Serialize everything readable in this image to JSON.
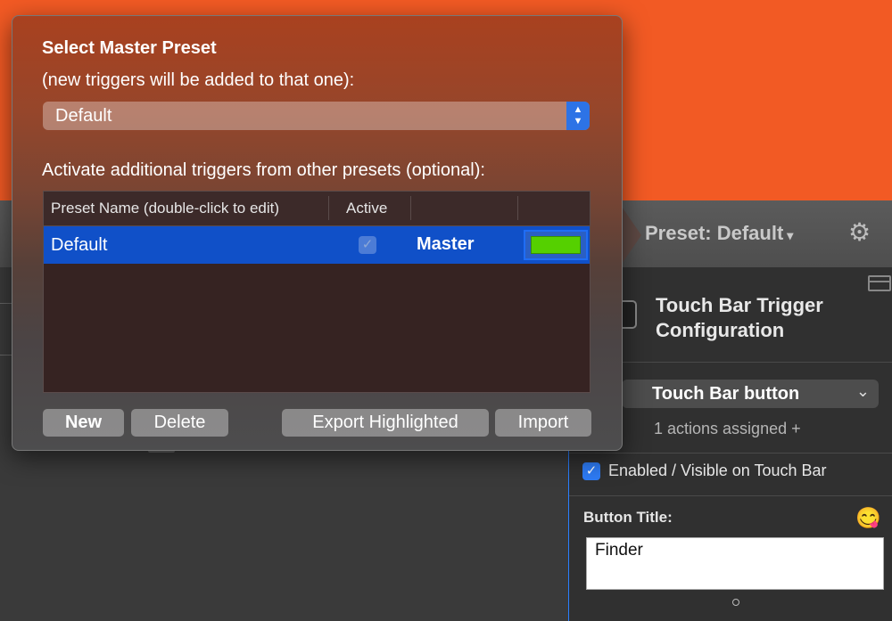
{
  "colors": {
    "background_orange": "#f25a24",
    "selection_blue": "#1050c8",
    "accent_blue": "#2e7cf6",
    "swatch_green": "#55d000"
  },
  "toolbar": {
    "preset_label": "Preset: Default",
    "preset_arrow": "▾",
    "settings_icon": "gear-icon"
  },
  "trigger_config": {
    "title": "Touch Bar Trigger Configuration",
    "trigger_type": "Touch Bar button",
    "actions_assigned": "1 actions assigned +",
    "enabled_label": "Enabled / Visible on Touch Bar",
    "enabled_checked": true,
    "button_title_label": "Button Title:",
    "emoji_picker_icon": "😋",
    "button_title_value": "Finder"
  },
  "popover": {
    "title": "Select Master Preset",
    "subtitle": "(new triggers will be added to that one):",
    "master_select": {
      "value": "Default"
    },
    "additional_label": "Activate additional triggers from other presets (optional):",
    "table": {
      "columns": [
        "Preset Name (double-click to edit)",
        "Active",
        "",
        ""
      ],
      "rows": [
        {
          "name": "Default",
          "active": true,
          "role": "Master",
          "color": "#55d000",
          "selected": true
        }
      ]
    },
    "buttons": {
      "new": "New",
      "delete": "Delete",
      "export": "Export Highlighted",
      "import": "Import"
    }
  }
}
